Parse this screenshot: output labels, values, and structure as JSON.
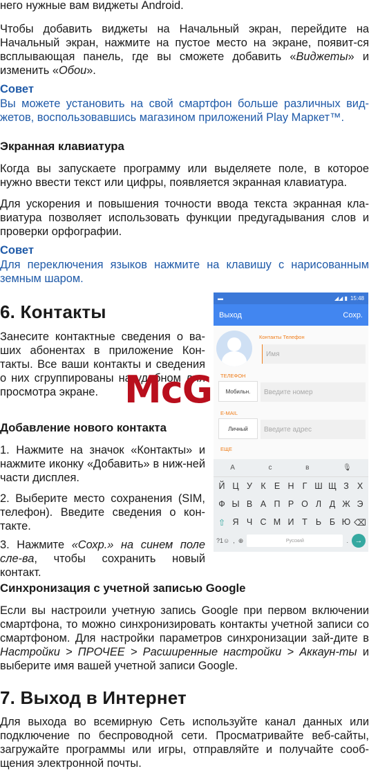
{
  "intro": {
    "line0": "него нужные вам виджеты Android.",
    "para_a": "Чтобы добавить виджеты на Начальный экран, перейдите на Начальный экран, нажмите на пустое место на экране, появит-ся всплывающая панель, где вы сможете добавить «",
    "para_em1": "Виджеты",
    "para_b": "» и изменить «",
    "para_em2": "Обои",
    "para_c": "»."
  },
  "tip1": {
    "heading": "Совет",
    "text": "Вы можете установить на свой смартфон больше различных вид-жетов, воспользовавшись магазином приложений Play Маркет™."
  },
  "keyboard_section": {
    "heading": "Экранная клавиатура",
    "p1": "Когда вы запускаете программу или выделяете поле, в которое нужно ввести текст или цифры, появляется экранная клавиатура.",
    "p2": "Для ускорения и повышения точности ввода текста экранная кла-виатура позволяет использовать функции предугадывания слов и проверки орфографии."
  },
  "tip2": {
    "heading": "Совет",
    "text": "Для переключения языков нажмите на клавишу  с нарисованным земным шаром."
  },
  "contacts": {
    "heading": "6. Контакты",
    "p1": "Занесите контактные сведения о ва-ших абонентах в приложение Кон-такты. Все ваши контакты и сведения о них сгруппированы на удобном для просмотра экране.",
    "sub_heading": "Добавление нового контакта",
    "step1": "1. Нажмите на значок «Контакты» и нажмите иконку «Добавить» в ниж-ней части дисплея.",
    "step2": "2. Выберите место сохранения (SIM, телефон). Введите сведения о кон-такте.",
    "step3_a": "3. Нажмите ",
    "step3_em": "«Сохр.» на синем поле сле-ва",
    "step3_b": ", чтобы сохранить новый контакт."
  },
  "sync": {
    "heading": "Синхронизация с учетной записью Google",
    "p_a": "Если вы настроили учетную запись Google при первом включении смартфона, то можно синхронизировать контакты учетной записи со смартфоном. Для настройки параметров синхронизации зай-дите в ",
    "p_em": "Настройки > ПРОЧЕЕ > Расширенные настройки > Аккаун-ты",
    "p_b": " и выберите имя вашей учетной записи Google."
  },
  "internet": {
    "heading": "7. Выход в Интернет",
    "p1": "Для выхода во всемирную Сеть используйте канал данных или подключение по беспроводной сети. Просматривайте веб-сайты, загружайте программы или игры, отправляйте и получайте сооб-щения электронной почты."
  },
  "watermark": "McGrp.Ru",
  "phone": {
    "status_time": "15:48",
    "status_icons": "◢◢ ▮",
    "exit_label": "Выход",
    "save_label": "Сохр.",
    "account_label": "Контакты Телефон",
    "name_placeholder": "Имя",
    "phone_section": "ТЕЛЕФОН",
    "phone_type": "Мобильн.",
    "phone_placeholder": "Введите номер",
    "email_section": "E-MAIL",
    "email_type": "Личный",
    "email_placeholder": "Введите адрес",
    "more_label": "ЕЩЕ",
    "suggestions": [
      "А",
      "с",
      "в"
    ],
    "row1": [
      "Й",
      "Ц",
      "У",
      "К",
      "Е",
      "Н",
      "Г",
      "Ш",
      "Щ",
      "З",
      "Х"
    ],
    "row2": [
      "Ф",
      "Ы",
      "В",
      "А",
      "П",
      "Р",
      "О",
      "Л",
      "Д",
      "Ж",
      "Э"
    ],
    "row3": [
      "Я",
      "Ч",
      "С",
      "М",
      "И",
      "Т",
      "Ь",
      "Б",
      "Ю"
    ],
    "symbols_key": "?1☺",
    "comma_key": ",",
    "globe_key": "⊕",
    "space_label": "Русский",
    "period_key": ".",
    "enter_key": "→",
    "shift_key": "⇧",
    "backspace_key": "⌫",
    "mic_key": "🎙"
  }
}
